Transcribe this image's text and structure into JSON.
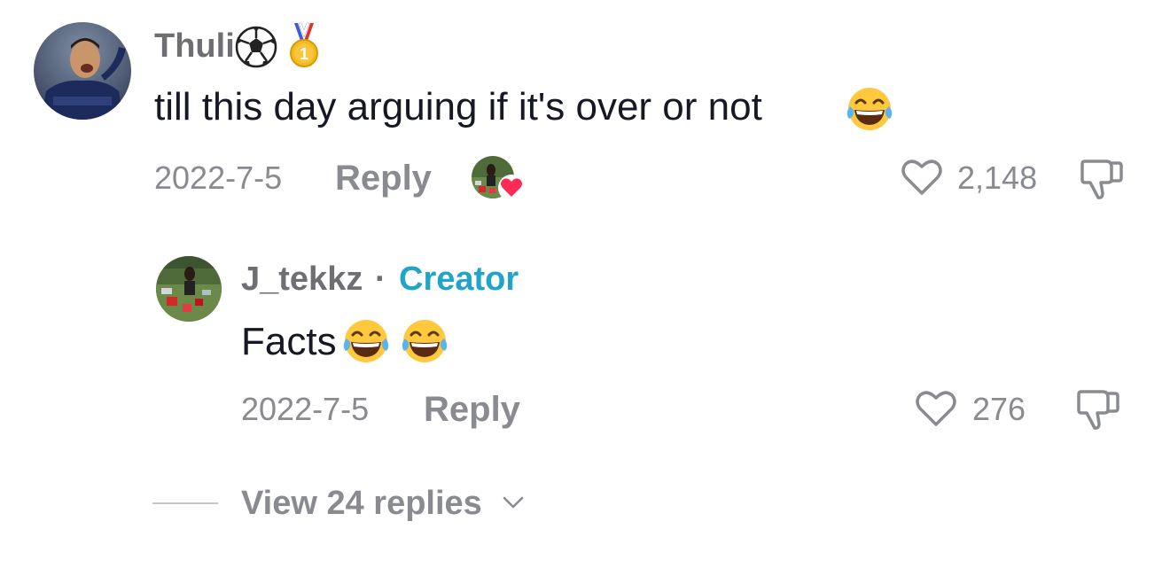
{
  "comment": {
    "username": "Thuli",
    "username_emojis": [
      "soccer-ball-icon",
      "medal-icon"
    ],
    "text": "till this day arguing if it's over or not",
    "text_emoji": "laughing-tears-emoji",
    "date": "2022-7-5",
    "reply_label": "Reply",
    "like_count": "2,148",
    "creator_liked": true
  },
  "reply": {
    "username": "J_tekkz",
    "separator": "·",
    "badge": "Creator",
    "text": "Facts",
    "text_emojis": [
      "laughing-tears-emoji",
      "laughing-tears-emoji"
    ],
    "date": "2022-7-5",
    "reply_label": "Reply",
    "like_count": "276"
  },
  "thread": {
    "view_replies_label": "View 24 replies"
  },
  "colors": {
    "username": "#6e6e73",
    "text": "#161823",
    "meta": "#8a8b91",
    "creator_badge": "#20a5c8",
    "heart_badge": "#fe2c55"
  }
}
